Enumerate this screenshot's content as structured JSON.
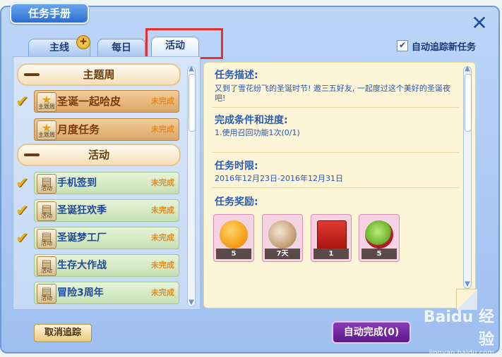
{
  "window": {
    "title": "任务手册",
    "close_glyph": "✕"
  },
  "tabs": [
    {
      "label": "主线",
      "badge": "✚"
    },
    {
      "label": "每日"
    },
    {
      "label": "活动",
      "active": true
    }
  ],
  "auto_track": {
    "label": "自动追踪新任务",
    "checked": true
  },
  "sections": [
    {
      "title": "主题周",
      "quests": [
        {
          "name": "圣诞一起哈皮",
          "status": "未完成",
          "icon_label": "主题周",
          "icon": "star-icon",
          "tracked": true
        },
        {
          "name": "月度任务",
          "status": "未完成",
          "icon_label": "主题周",
          "icon": "star-icon",
          "tracked": false
        }
      ]
    },
    {
      "title": "活动",
      "quests": [
        {
          "name": "手机签到",
          "status": "未完成",
          "icon_label": "活动",
          "icon": "scroll-icon",
          "tracked": true
        },
        {
          "name": "圣诞狂欢季",
          "status": "未完成",
          "icon_label": "活动",
          "icon": "scroll-icon",
          "tracked": true
        },
        {
          "name": "圣诞梦工厂",
          "status": "未完成",
          "icon_label": "活动",
          "icon": "scroll-icon",
          "tracked": true
        },
        {
          "name": "生存大作战",
          "status": "未完成",
          "icon_label": "活动",
          "icon": "scroll-icon",
          "tracked": false
        },
        {
          "name": "冒险3周年",
          "status": "未完成",
          "icon_label": "活动",
          "icon": "scroll-icon",
          "tracked": false
        }
      ]
    }
  ],
  "detail": {
    "desc_heading": "任务描述:",
    "desc_text": "又到了雪花纷飞的圣诞时节! 邀三五好友, 一起度过这个美好的圣诞夜吧!",
    "cond_heading": "完成条件和进度:",
    "cond_text": "1.使用召回功能1次(0/1)",
    "time_heading": "任务时限:",
    "time_text": "2016年12月23日-2016年12月31日",
    "reward_heading": "任务奖励:",
    "rewards": [
      {
        "icon": "orange-fruit-icon",
        "count": "5",
        "color": "#f6a21c"
      },
      {
        "icon": "snail-pet-icon",
        "count": "7天",
        "color": "#c9a37a"
      },
      {
        "icon": "red-envelope-icon",
        "count": "1",
        "color": "#c8231f"
      },
      {
        "icon": "growth-apple-icon",
        "count": "5",
        "color": "#8bd14a"
      }
    ]
  },
  "buttons": {
    "cancel_track": "取消追踪",
    "auto_complete": "自动完成(0)"
  },
  "watermark": {
    "text": "Baidu 经验",
    "url": "jingyan.baidu.com"
  },
  "colors": {
    "status_incomplete": "#e58a1f",
    "check": "#e9b10f",
    "highlight": "#e6312a"
  }
}
